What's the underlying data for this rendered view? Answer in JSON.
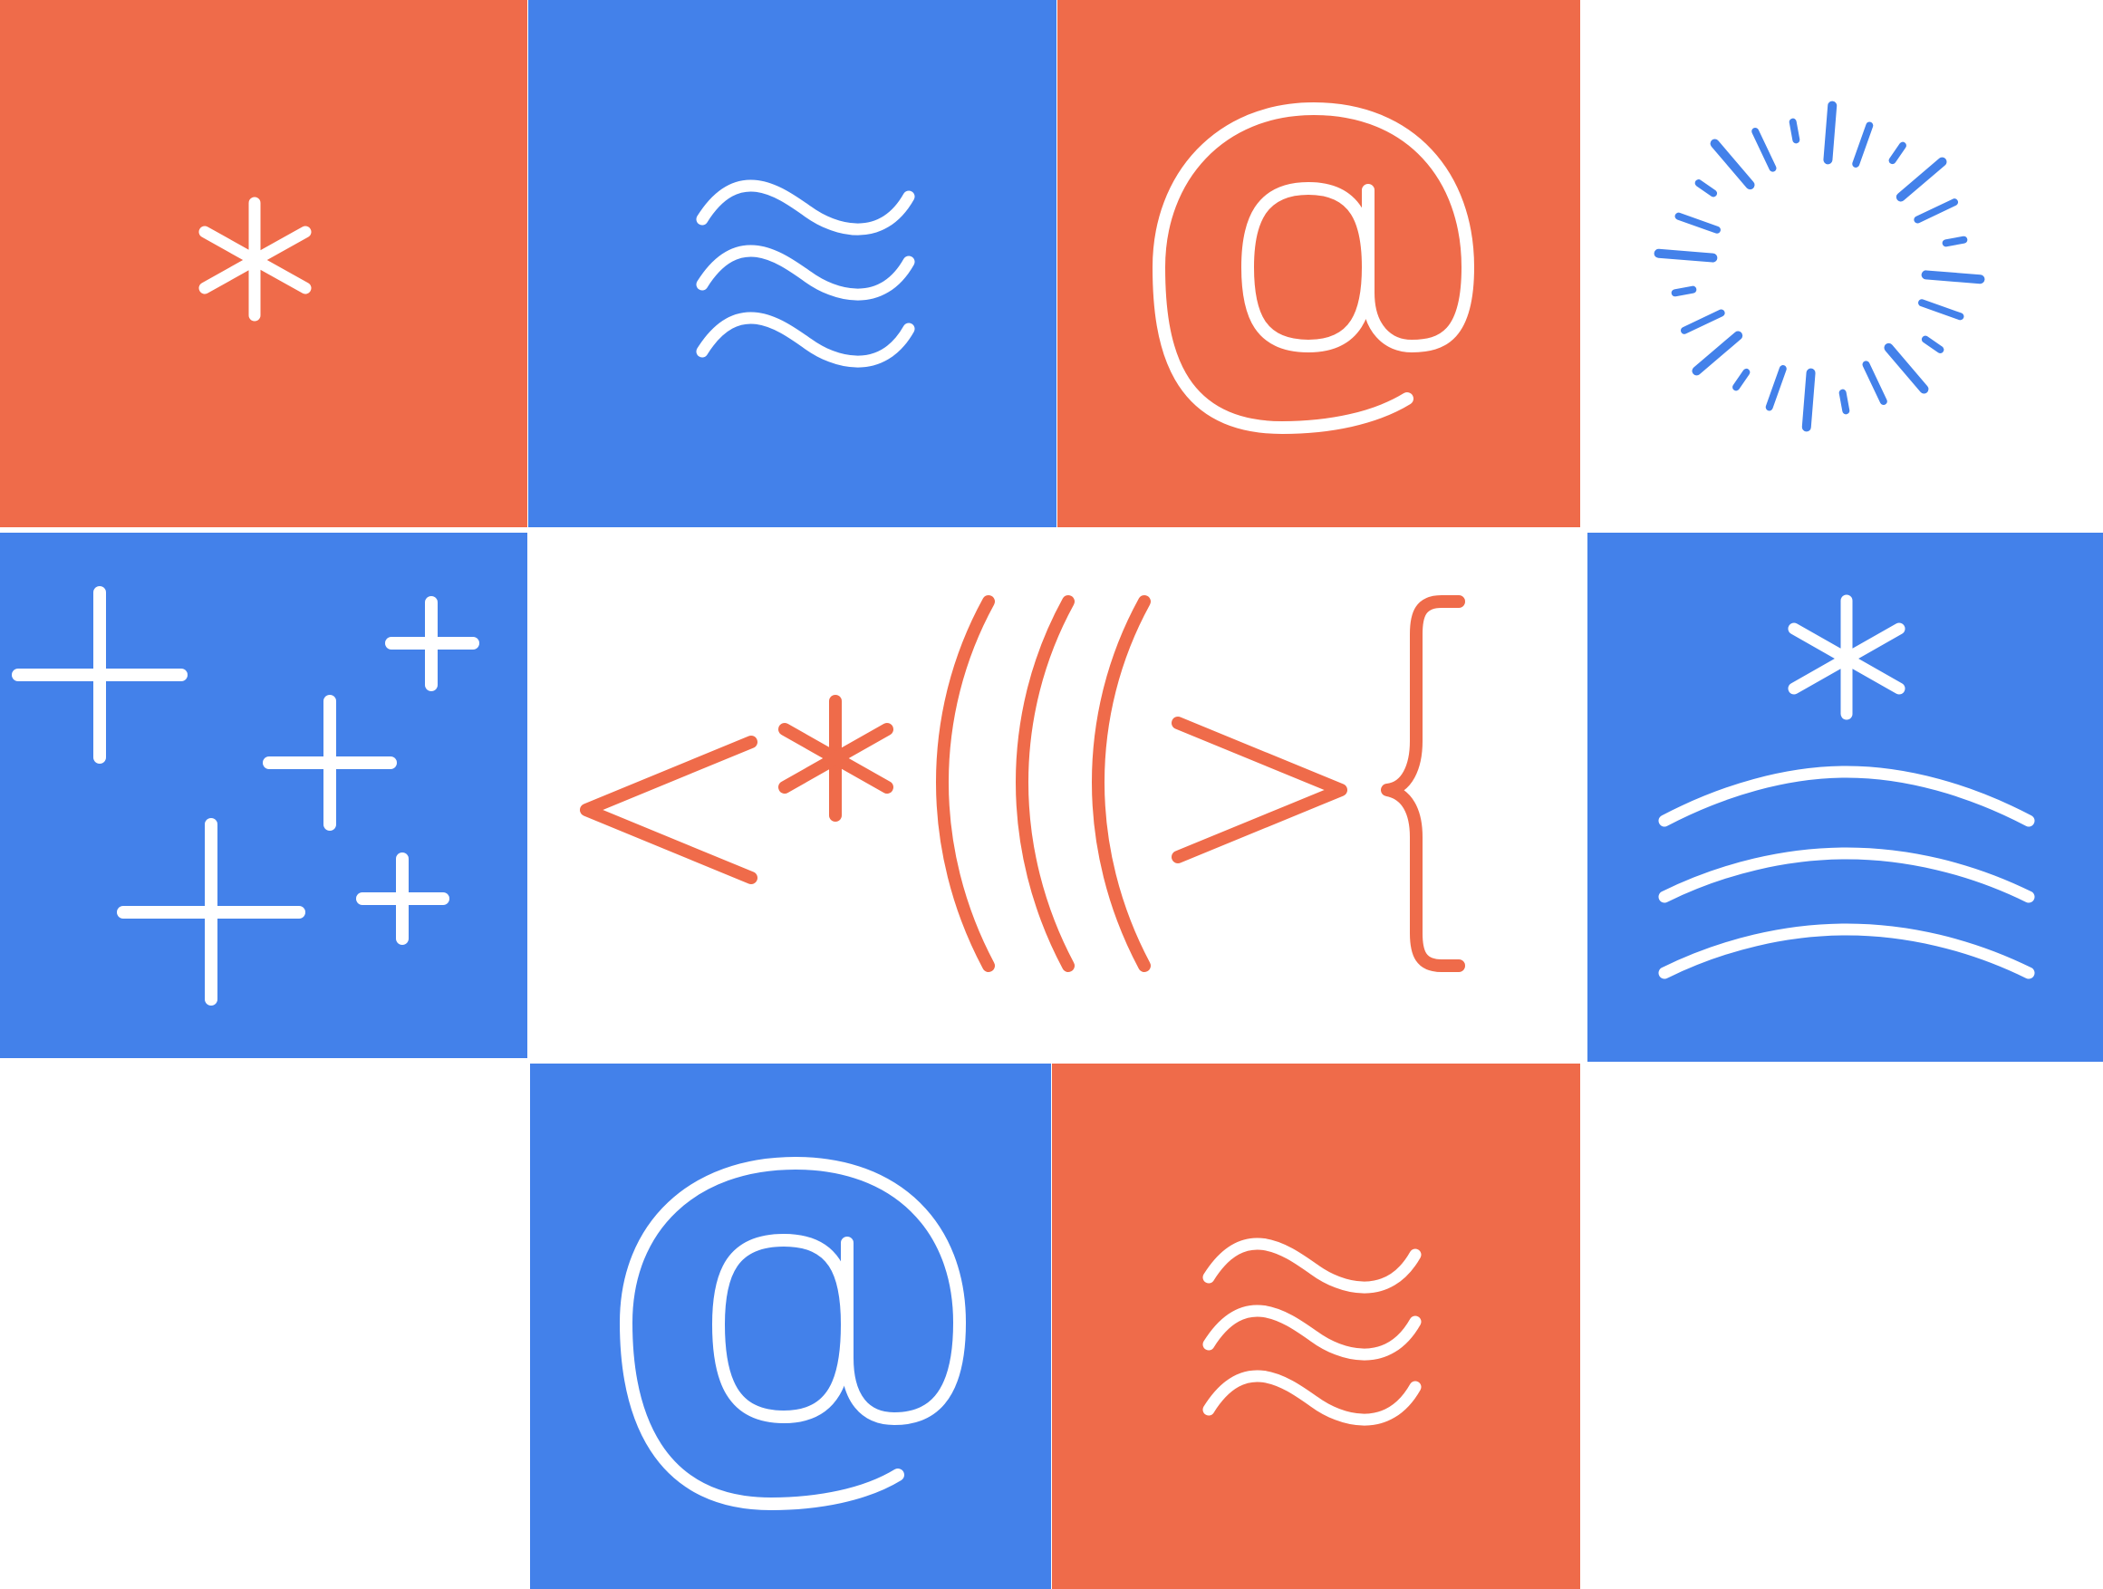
{
  "palette": {
    "orange": "#EF6B4A",
    "blue": "#4381EA",
    "white": "#FFFFFF"
  },
  "tiles": [
    {
      "row": 1,
      "col": 1,
      "background": "orange",
      "glyph": "asterisk-icon"
    },
    {
      "row": 1,
      "col": 2,
      "background": "blue",
      "glyph": "triple-tilde-icon"
    },
    {
      "row": 1,
      "col": 3,
      "background": "orange",
      "glyph": "at-sign-icon"
    },
    {
      "row": 1,
      "col": 4,
      "background": "white",
      "glyph": "burst-icon"
    },
    {
      "row": 2,
      "col": 1,
      "background": "blue",
      "glyph": "plus-cluster-icon"
    },
    {
      "row": 2,
      "col": "2-3",
      "background": "white",
      "glyph": "symbol-string-icon"
    },
    {
      "row": 2,
      "col": 4,
      "background": "blue",
      "glyph": "asterisk-over-arcs-icon"
    },
    {
      "row": 3,
      "col": 2,
      "background": "blue",
      "glyph": "at-sign-icon"
    },
    {
      "row": 3,
      "col": 3,
      "background": "orange",
      "glyph": "triple-tilde-icon"
    }
  ]
}
